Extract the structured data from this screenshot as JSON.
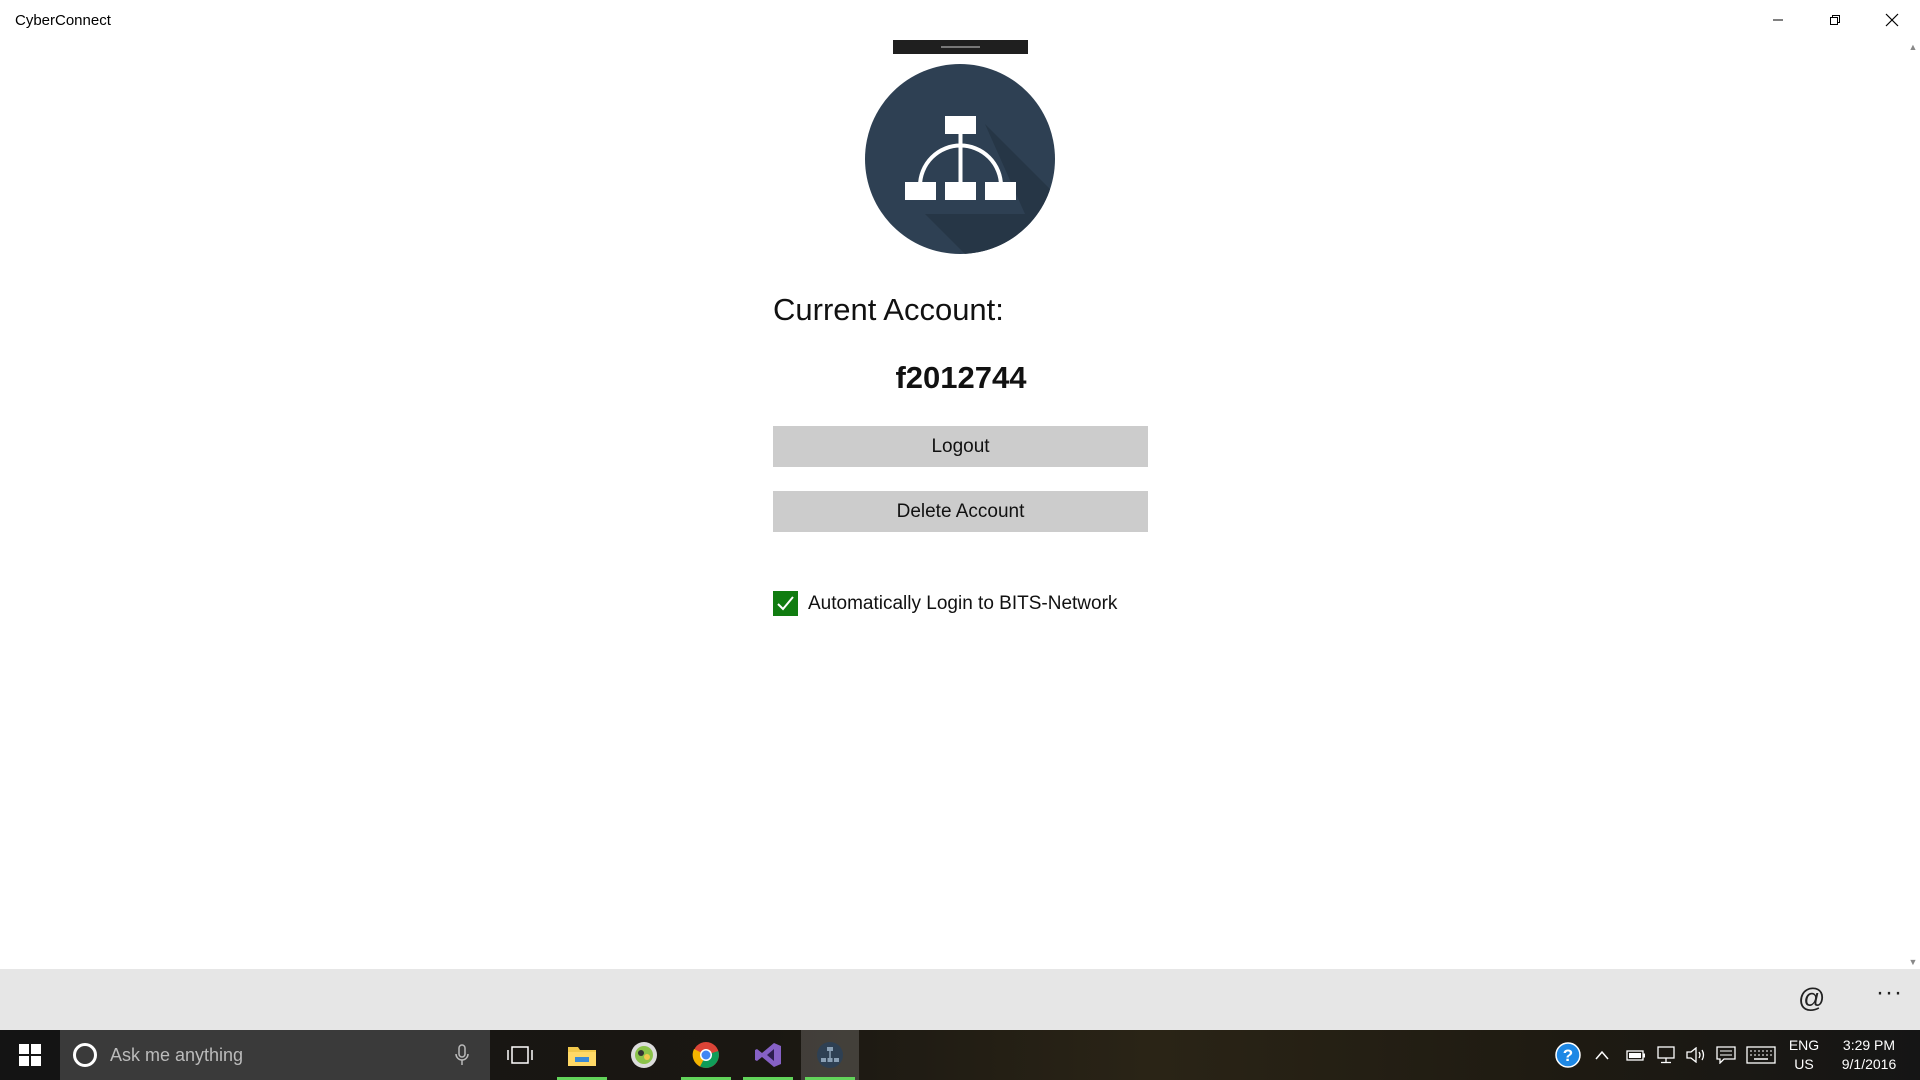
{
  "window": {
    "title": "CyberConnect",
    "controls": {
      "minimize_icon": "minimize-icon",
      "restore_icon": "restore-icon",
      "close_icon": "close-icon"
    }
  },
  "main": {
    "logo_icon": "network-hierarchy-icon",
    "logo_color": "#2e4053",
    "account_label": "Current Account:",
    "account_id": "f2012744",
    "logout_label": "Logout",
    "delete_label": "Delete Account",
    "auto_login": {
      "label": "Automatically Login to BITS-Network",
      "checked": true,
      "color": "#107c10"
    }
  },
  "command_bar": {
    "at_label": "@",
    "more_label": "···"
  },
  "taskbar": {
    "search_placeholder": "Ask me anything",
    "apps": [
      "task-view-icon",
      "file-explorer-icon",
      "game-app-icon",
      "chrome-icon",
      "visual-studio-icon",
      "cyberconnect-icon"
    ],
    "language": [
      "ENG",
      "US"
    ],
    "time": "3:29 PM",
    "date": "9/1/2016"
  }
}
